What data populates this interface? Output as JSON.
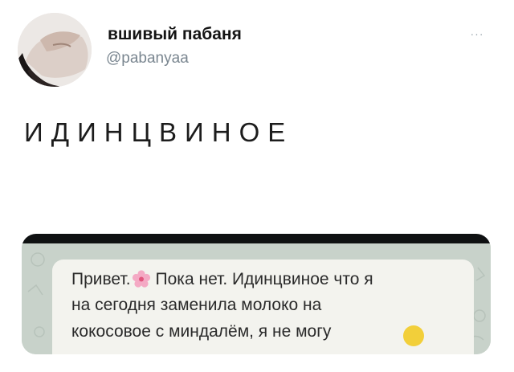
{
  "author": {
    "display_name": "вшивый пабаня",
    "handle": "@pabanyaa",
    "avatar": "profile-photo"
  },
  "tweet": {
    "text": "ИДИНЦВИНОЕ"
  },
  "toolbar": {
    "more_icon": "more-dots-icon",
    "more_label": "···"
  },
  "media": {
    "chat_message": {
      "line1_before_emoji": "Привет.",
      "emoji": "cherry-blossom-icon",
      "line1_after_emoji": "Пока нет. Идинцвиное что я",
      "line2": "на сегодня заменила молоко на",
      "line3": "кокосовое с миндалём, я не могу"
    }
  },
  "colors": {
    "handle": "#7a8690",
    "bubble": "#f3f3ee",
    "chat_background": "#c8d2ca"
  }
}
